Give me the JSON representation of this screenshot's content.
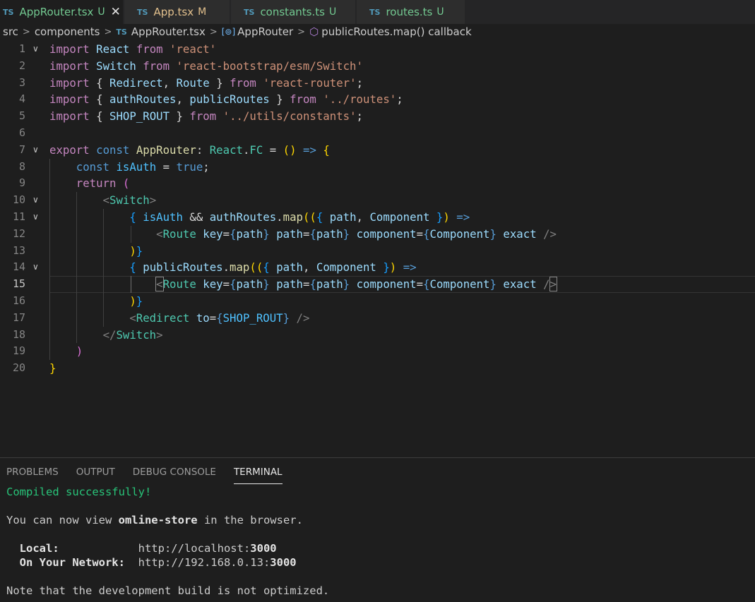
{
  "tabs": [
    {
      "icon": "TS",
      "label": "AppRouter.tsx",
      "status": "U",
      "active": true,
      "close": "✕"
    },
    {
      "icon": "TS",
      "label": "App.tsx",
      "status": "M",
      "active": false
    },
    {
      "icon": "TS",
      "label": "constants.ts",
      "status": "U",
      "active": false
    },
    {
      "icon": "TS",
      "label": "routes.ts",
      "status": "U",
      "active": false
    }
  ],
  "breadcrumb": {
    "src": "src",
    "components": "components",
    "file_icon": "TS",
    "file": "AppRouter.tsx",
    "symbol_icon": "[⊚]",
    "symbol": "AppRouter",
    "callback_icon": "⬡",
    "callback": "publicRoutes.map() callback",
    "sep": ">"
  },
  "editor": {
    "current_line": 15,
    "line_numbers": [
      "1",
      "2",
      "3",
      "4",
      "5",
      "6",
      "7",
      "8",
      "9",
      "10",
      "11",
      "12",
      "13",
      "14",
      "15",
      "16",
      "17",
      "18",
      "19",
      "20"
    ],
    "fold_marker": "∨",
    "code": {
      "import": "import",
      "from": "from",
      "export": "export",
      "const": "const",
      "return": "return",
      "React": "React",
      "Switch": "Switch",
      "Redirect": "Redirect",
      "Route": "Route",
      "authRoutes": "authRoutes",
      "publicRoutes": "publicRoutes",
      "SHOP_ROUT": "SHOP_ROUT",
      "str_react": "'react'",
      "str_switch": "'react-bootstrap/esm/Switch'",
      "str_router": "'react-router'",
      "str_routes": "'../routes'",
      "str_constants": "'../utils/constants'",
      "AppRouter": "AppRouter",
      "FC": "FC",
      "isAuth": "isAuth",
      "true": "true",
      "map": "map",
      "path": "path",
      "Component": "Component",
      "key": "key",
      "component": "component",
      "exact": "exact",
      "to": "to"
    }
  },
  "panel": {
    "tabs": [
      "PROBLEMS",
      "OUTPUT",
      "DEBUG CONSOLE",
      "TERMINAL"
    ],
    "active_tab": "TERMINAL",
    "terminal": {
      "compiled": "Compiled successfully!",
      "view_pre": "You can now view ",
      "app": "omline-store",
      "view_post": " in the browser.",
      "local_label": "  Local:",
      "local_url_pre": "http://localhost:",
      "local_port": "3000",
      "network_label": "  On Your Network:",
      "network_url_pre": "http://192.168.0.13:",
      "network_port": "3000",
      "note": "Note that the development build is not optimized."
    }
  },
  "colors": {
    "background": "#1e1e1e",
    "keyword": "#569cd6",
    "control": "#c586c0",
    "string": "#ce9178",
    "variable": "#9cdcfe",
    "type": "#4ec9b0",
    "function": "#dcdcaa",
    "untracked": "#73c991",
    "modified": "#e2c08d"
  }
}
